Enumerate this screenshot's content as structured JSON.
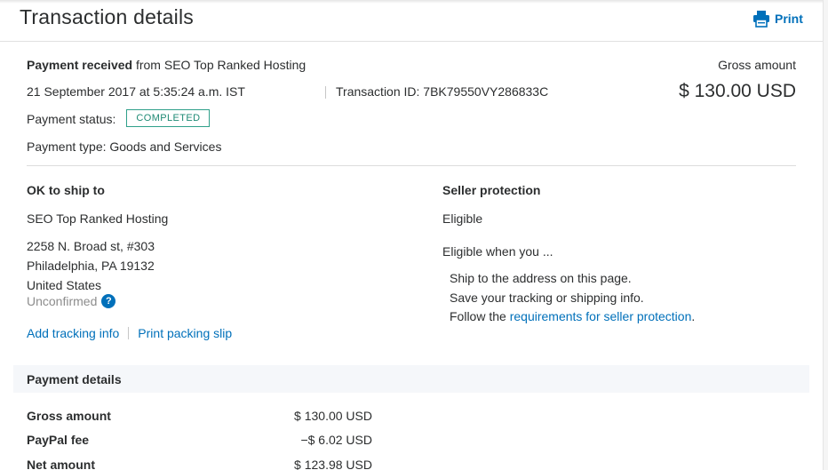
{
  "header": {
    "title": "Transaction details",
    "print_label": "Print"
  },
  "summary": {
    "payment_received_bold": "Payment received",
    "payment_received_rest": " from SEO Top Ranked Hosting",
    "datetime": "21 September 2017 at 5:35:24 a.m. IST",
    "transaction_id_label": "Transaction ID: ",
    "transaction_id": "7BK79550VY286833C",
    "gross_amount_label": "Gross amount",
    "gross_amount_value": "$ 130.00 USD",
    "payment_status_label": "Payment status:",
    "payment_status_value": "COMPLETED",
    "payment_type": "Payment type: Goods and Services"
  },
  "shipping": {
    "title": "OK to ship to",
    "name": "SEO Top Ranked Hosting",
    "address_line1": "2258 N. Broad st, #303",
    "address_line2": "Philadelphia, PA 19132",
    "address_line3": "United States",
    "status": "Unconfirmed",
    "help_glyph": "?",
    "add_tracking": "Add tracking info",
    "print_packing": "Print packing slip"
  },
  "seller_protection": {
    "title": "Seller protection",
    "status": "Eligible",
    "when_label": "Eligible when you ...",
    "item1": "Ship to the address on this page.",
    "item2": "Save your tracking or shipping info.",
    "item3_prefix": "Follow the ",
    "item3_link": "requirements for seller protection",
    "item3_suffix": "."
  },
  "payment_details": {
    "title": "Payment details",
    "rows": [
      {
        "label": "Gross amount",
        "value": "$ 130.00 USD"
      },
      {
        "label": "PayPal fee",
        "value": "−$ 6.02 USD"
      },
      {
        "label": "Net amount",
        "value": "$ 123.98 USD"
      }
    ]
  },
  "colors": {
    "link": "#0070ba",
    "badge": "#2fa08a",
    "muted": "#8c8c8c"
  }
}
